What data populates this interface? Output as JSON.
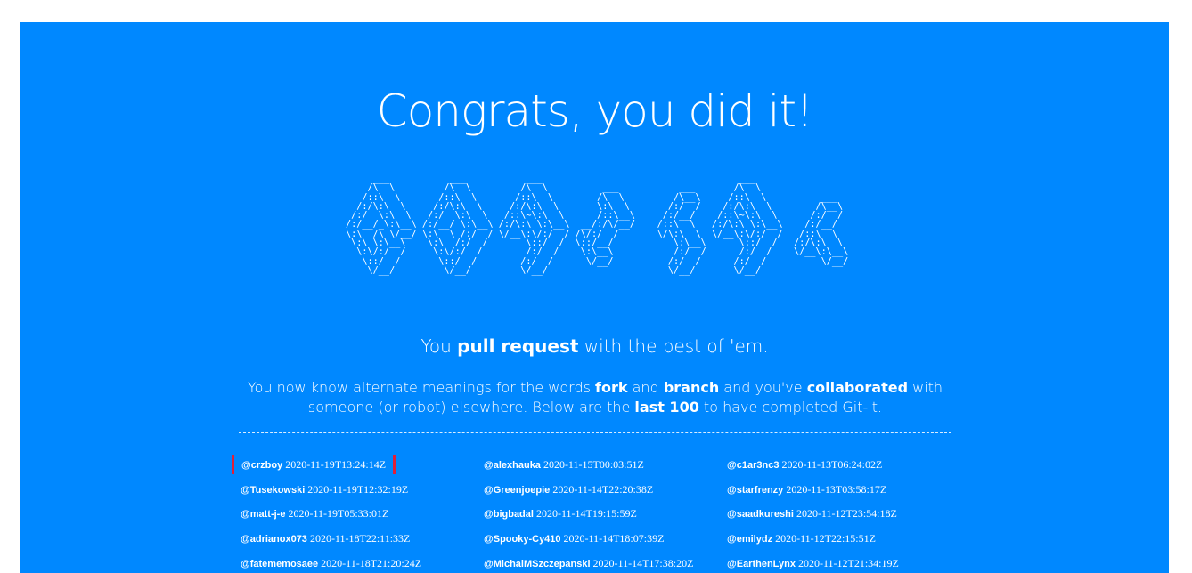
{
  "heading": "Congrats, you did it!",
  "ascii_art": "     ___           ___           ___                                    ___                    \n    /\\  \\         /\\  \\         /\\  \\          ___           ___       /\\  \\                   \n   /::\\  \\       /::\\  \\       /::\\  \\        /\\  \\         /\\__\\     /::\\  \\          ___     \n  /:/\\:\\  \\     /:/\\:\\  \\     /:/\\:\\  \\       \\:\\  \\       /:/  /    /:/\\:\\  \\        /\\__\\    \n /:/  \\:\\  \\   /:/  \\:\\  \\   /::\\~\\:\\  \\      /::\\__\\     /:/__/    /::\\~\\:\\  \\      /:/  /    \n/:/__/_\\:\\__\\ /:/__/ \\:\\__\\ /:/\\:\\ \\:\\__\\  __/:/\\/__/    /::\\  \\   /:/\\:\\ \\:\\__\\    /:/__/     \n\\:\\  /\\ \\/__/ \\:\\  \\ /:/  / \\/__\\:\\/:/  / /\\/:/  /       \\/\\:\\  \\  \\/__\\:\\/:/  /   /::\\  \\     \n \\:\\ \\:\\__\\    \\:\\  /:/  /       \\::/  /  \\::/__/           \\:\\__\\      \\::/  /   /:/\\:\\  \\    \n  \\:\\/:/  /     \\:\\/:/  /        /:/  /    \\:\\__\\           /:/  /      /:/  /    \\/__\\:\\__\\   \n   \\::/  /       \\::/  /        /:/  /      \\/__/          /:/  /      /:/  /          \\/__/   \n    \\/__/         \\/__/         \\/__/                      \\/__/       \\/__/                   ",
  "tagline": {
    "prefix": "You ",
    "bold": "pull request",
    "suffix": " with the best of 'em."
  },
  "description": {
    "p1": "You now know alternate meanings for the words ",
    "b1": "fork",
    "p2": " and ",
    "b2": "branch",
    "p3": " and you've ",
    "b3": "collaborated",
    "p4": " with someone (or robot) elsewhere. Below are the ",
    "b4": "last 100",
    "p5": " to have completed Git-it."
  },
  "completions": [
    {
      "user": "@crzboy",
      "time": "2020-11-19T13:24:14Z",
      "current": true
    },
    {
      "user": "@Tusekowski",
      "time": "2020-11-19T12:32:19Z"
    },
    {
      "user": "@matt-j-e",
      "time": "2020-11-19T05:33:01Z"
    },
    {
      "user": "@adrianox073",
      "time": "2020-11-18T22:11:33Z"
    },
    {
      "user": "@fatememosaee",
      "time": "2020-11-18T21:20:24Z"
    },
    {
      "user": "@alexhauka",
      "time": "2020-11-15T00:03:51Z"
    },
    {
      "user": "@Greenjoepie",
      "time": "2020-11-14T22:20:38Z"
    },
    {
      "user": "@bigbadal",
      "time": "2020-11-14T19:15:59Z"
    },
    {
      "user": "@Spooky-Cy410",
      "time": "2020-11-14T18:07:39Z"
    },
    {
      "user": "@MichalMSzczepanski",
      "time": "2020-11-14T17:38:20Z"
    },
    {
      "user": "@c1ar3nc3",
      "time": "2020-11-13T06:24:02Z"
    },
    {
      "user": "@starfrenzy",
      "time": "2020-11-13T03:58:17Z"
    },
    {
      "user": "@saadkureshi",
      "time": "2020-11-12T23:54:18Z"
    },
    {
      "user": "@emilydz",
      "time": "2020-11-12T22:15:51Z"
    },
    {
      "user": "@EarthenLynx",
      "time": "2020-11-12T21:34:19Z"
    }
  ],
  "colors": {
    "background": "#0088ff",
    "highlight": "#e0203a",
    "text": "#ffffff"
  }
}
